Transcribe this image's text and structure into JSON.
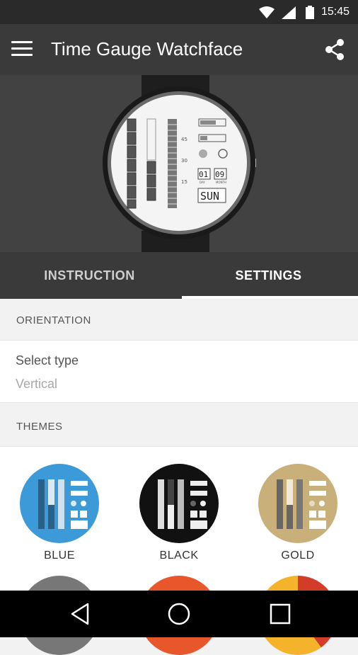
{
  "status_bar": {
    "time": "15:45",
    "icons": [
      "wifi-icon",
      "signal-icon",
      "battery-icon"
    ]
  },
  "app_bar": {
    "title": "Time Gauge Watchface",
    "menu_icon": "hamburger-menu-icon",
    "share_icon": "share-icon"
  },
  "hero": {
    "watch_scale": [
      "45",
      "30",
      "15"
    ],
    "day_month": [
      "01",
      "09"
    ],
    "day_month_labels": [
      "DAY",
      "MONTH"
    ],
    "weekday": "SUN"
  },
  "tabs": [
    {
      "label": "INSTRUCTION",
      "selected": false
    },
    {
      "label": "SETTINGS",
      "selected": true
    }
  ],
  "orientation": {
    "section_title": "ORIENTATION",
    "label": "Select type",
    "value": "Vertical"
  },
  "themes": {
    "section_title": "THEMES",
    "items": [
      {
        "name": "BLUE",
        "color": "#3d9ad8"
      },
      {
        "name": "BLACK",
        "color": "#111111"
      },
      {
        "name": "GOLD",
        "color": "#c9b07a"
      }
    ]
  },
  "nav_bar": {
    "buttons": [
      "back-icon",
      "home-icon",
      "recents-icon"
    ]
  }
}
